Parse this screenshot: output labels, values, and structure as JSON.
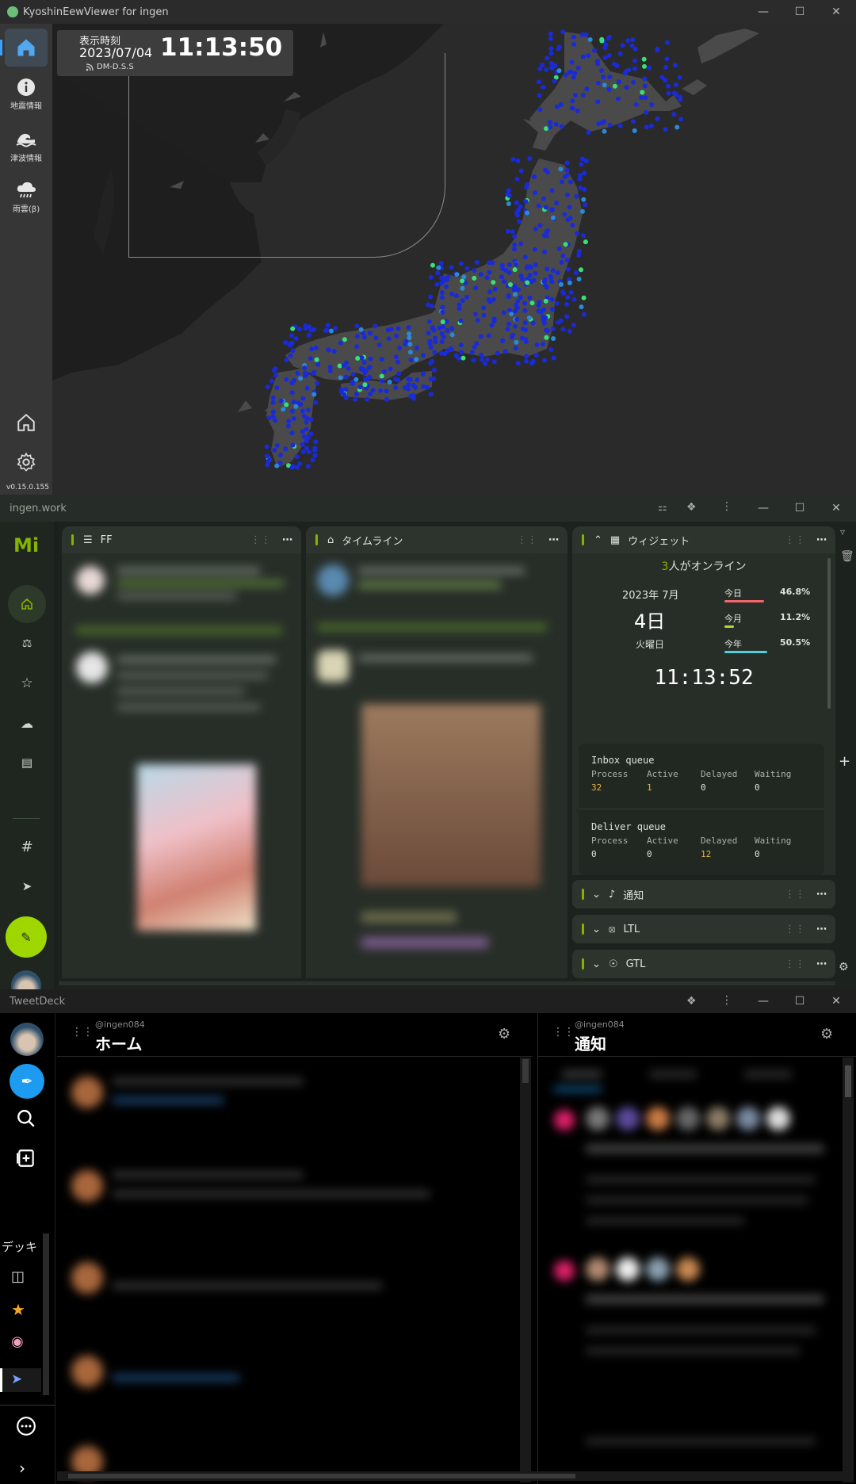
{
  "kyoshin": {
    "window_title": "KyoshinEewViewer for ingen",
    "clock_label": "表示時刻",
    "date": "2023/07/04",
    "time": "11:13:50",
    "source": "DM-D.S.S",
    "version": "v0.15.0.155",
    "sidebar": [
      {
        "label": "地震情報",
        "icon": "info-icon"
      },
      {
        "label": "津波情報",
        "icon": "tsunami-icon"
      },
      {
        "label": "雨雲(β)",
        "icon": "rain-cloud-icon"
      }
    ]
  },
  "misskey": {
    "window_title": "ingen.work",
    "logo": "Mi",
    "columns": {
      "ff": {
        "title": "FF"
      },
      "timeline": {
        "title": "タイムライン"
      },
      "widget": {
        "title": "ウィジェット"
      }
    },
    "online": {
      "count": "3",
      "suffix": "人がオンライン"
    },
    "calendar": {
      "year_month": "2023年 7月",
      "day": "4日",
      "weekday": "火曜日",
      "rows": [
        {
          "label": "今日",
          "value": "46.8%",
          "fraction": 0.468,
          "color": "#f0666a"
        },
        {
          "label": "今月",
          "value": "11.2%",
          "fraction": 0.112,
          "color": "#b8d63a"
        },
        {
          "label": "今年",
          "value": "50.5%",
          "fraction": 0.505,
          "color": "#4fd0dc"
        }
      ]
    },
    "digital_clock": "11:13:52",
    "inbox": {
      "title": "Inbox queue",
      "headers": [
        "Process",
        "Active",
        "Delayed",
        "Waiting"
      ],
      "values": [
        "32",
        "1",
        "0",
        "0"
      ]
    },
    "deliver": {
      "title": "Deliver queue",
      "headers": [
        "Process",
        "Active",
        "Delayed",
        "Waiting"
      ],
      "values": [
        "0",
        "0",
        "12",
        "0"
      ]
    },
    "collapsed_columns": [
      "通知",
      "LTL",
      "GTL"
    ],
    "accent": "#86b300"
  },
  "tweetdeck": {
    "window_title": "TweetDeck",
    "home": {
      "account": "@ingen084",
      "title": "ホーム"
    },
    "notifications": {
      "account": "@ingen084",
      "title": "通知"
    },
    "deck_label": "デッキ",
    "accent": "#1d9bf0"
  }
}
